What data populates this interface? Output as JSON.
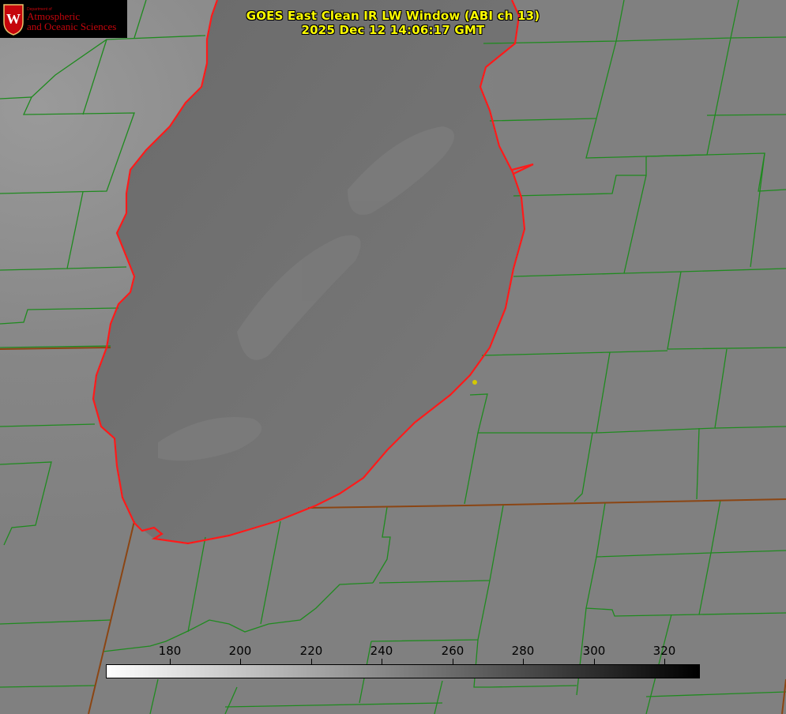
{
  "title": {
    "line1": "GOES East Clean IR LW Window (ABI ch 13)",
    "line2": "2025 Dec 12 14:06:17 GMT"
  },
  "logo": {
    "department": "Department of",
    "line1": "Atmospheric",
    "line2": "and Oceanic Sciences",
    "crest_letter": "W"
  },
  "colorbar": {
    "min": 162,
    "max": 330,
    "gradient_start_color": "#ffffff",
    "gradient_end_color": "#000000",
    "ticks": [
      180,
      200,
      220,
      240,
      260,
      280,
      300,
      320
    ]
  },
  "map": {
    "lake_color": "#6e6e6e",
    "land_color": "#828282",
    "shoreline_color": "#ff1a1a",
    "boundary_color": "#1f8a1f",
    "marker_color": "#d4c800"
  }
}
